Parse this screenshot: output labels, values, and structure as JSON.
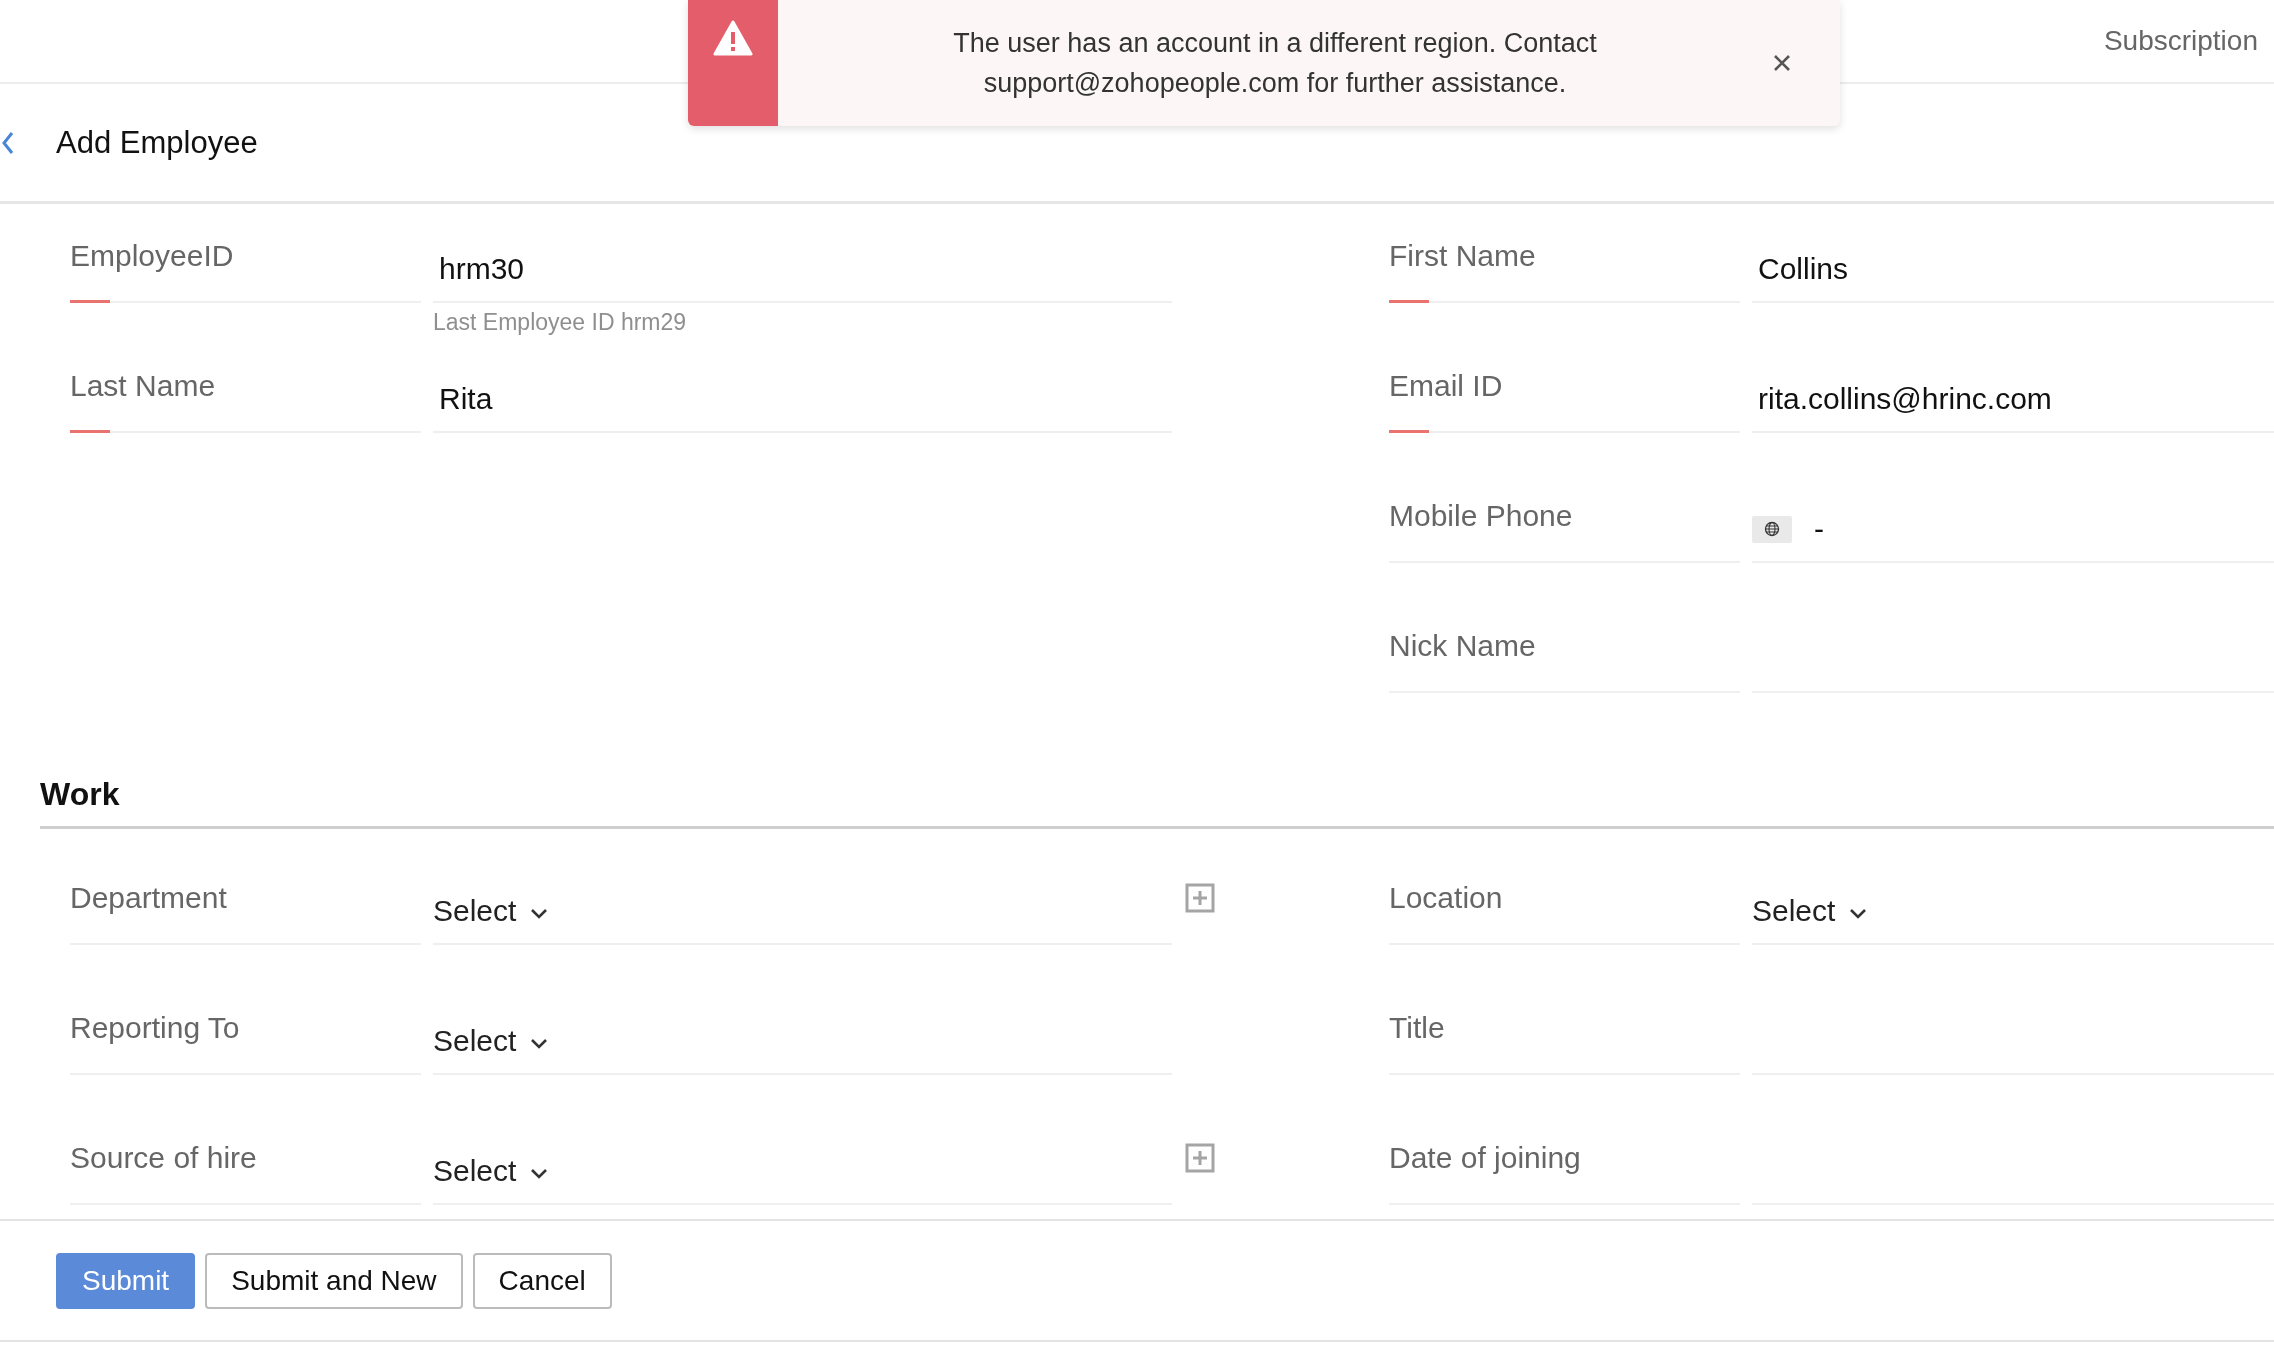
{
  "header": {
    "link": "Subscription"
  },
  "toast": {
    "message": "The user has an account in a different region. Contact support@zohopeople.com for further assistance."
  },
  "page": {
    "title": "Add Employee"
  },
  "personal": {
    "left": [
      {
        "label": "EmployeeID",
        "kind": "text",
        "value": "hrm30",
        "required": true,
        "hint": "Last Employee ID hrm29"
      },
      {
        "label": "Last Name",
        "kind": "text",
        "value": "Rita",
        "required": true
      }
    ],
    "right": [
      {
        "label": "First Name",
        "kind": "text",
        "value": "Collins",
        "required": true
      },
      {
        "label": "Email ID",
        "kind": "text",
        "value": "rita.collins@hrinc.com",
        "required": true
      },
      {
        "label": "Mobile Phone",
        "kind": "phone",
        "value": "-",
        "required": false
      },
      {
        "label": "Nick Name",
        "kind": "text",
        "required": false
      }
    ]
  },
  "work": {
    "heading": "Work",
    "left": [
      {
        "label": "Department",
        "kind": "select",
        "value": "Select",
        "required": false,
        "addable": true
      },
      {
        "label": "Reporting To",
        "kind": "select",
        "value": "Select",
        "required": false,
        "addable": false
      },
      {
        "label": "Source of hire",
        "kind": "select",
        "value": "Select",
        "required": false,
        "addable": true
      }
    ],
    "right": [
      {
        "label": "Location",
        "kind": "select",
        "value": "Select",
        "required": false
      },
      {
        "label": "Title",
        "kind": "text",
        "required": false
      },
      {
        "label": "Date of joining",
        "kind": "text",
        "required": false
      }
    ]
  },
  "buttons": [
    {
      "label": "Submit",
      "primary": true
    },
    {
      "label": "Submit and New",
      "primary": false
    },
    {
      "label": "Cancel",
      "primary": false
    }
  ]
}
